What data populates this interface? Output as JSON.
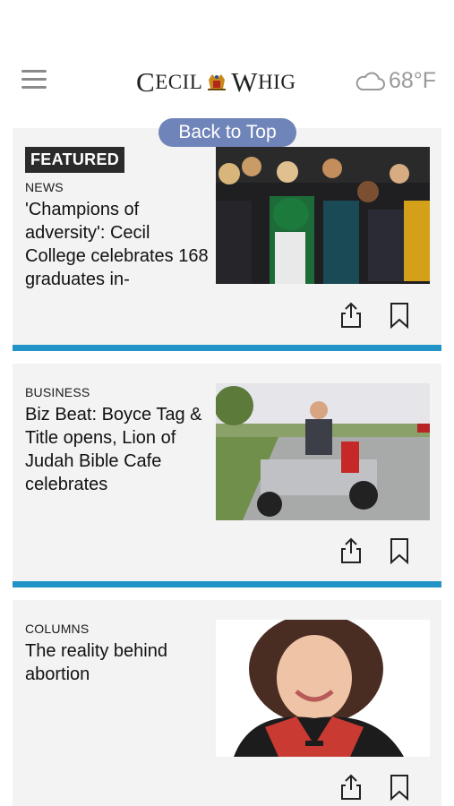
{
  "header": {
    "menu_icon": "hamburger-menu-icon",
    "logo_part1_big": "C",
    "logo_part1_small": "ECIL",
    "logo_part2_big": "W",
    "logo_part2_small": "HIG",
    "weather_icon": "cloud-icon",
    "temperature": "68°F"
  },
  "back_to_top": "Back to Top",
  "articles": [
    {
      "badge": "FEATURED",
      "section": "NEWS",
      "headline": "'Champions of adversity': Cecil College celebrates 168 graduates in-",
      "photo_icon": "graduation-photo"
    },
    {
      "section": "BUSINESS",
      "headline": "Biz Beat: Boyce Tag & Title opens, Lion of Judah Bible Cafe celebrates",
      "photo_icon": "mower-photo"
    },
    {
      "section": "COLUMNS",
      "headline": "The reality behind abortion",
      "photo_icon": "portrait-photo"
    }
  ],
  "colors": {
    "divider": "#2293c6",
    "back_to_top_bg": "#6f84b8",
    "card_bg": "#f3f3f3",
    "badge_bg": "#2b2b2b"
  }
}
